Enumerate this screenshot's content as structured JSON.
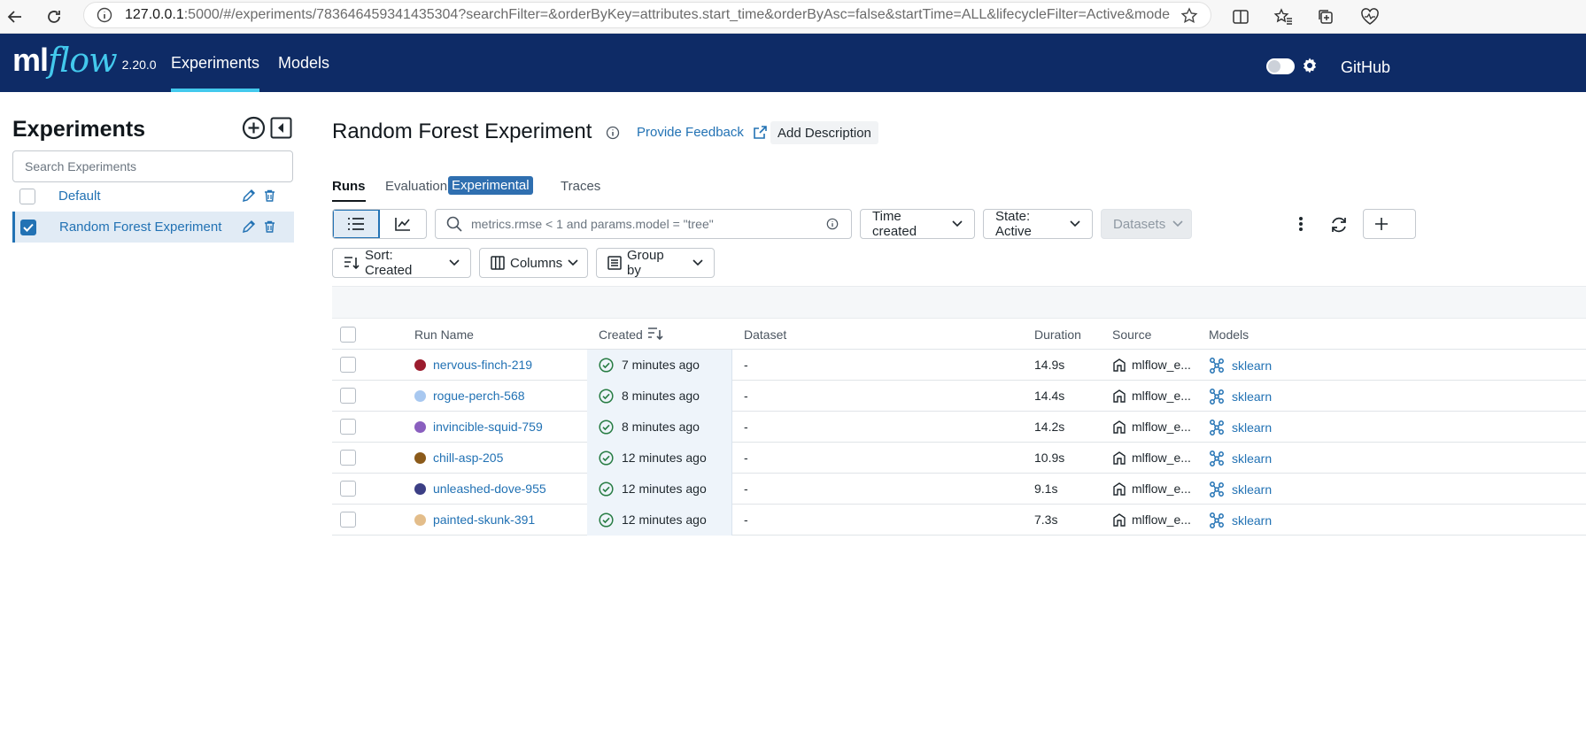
{
  "browser": {
    "url_host": "127.0.0.1",
    "url_rest": ":5000/#/experiments/783646459341435304?searchFilter=&orderByKey=attributes.start_time&orderByAsc=false&startTime=ALL&lifecycleFilter=Active&modelVers..."
  },
  "header": {
    "logo_ml": "ml",
    "logo_flow": "flow",
    "version": "2.20.0",
    "nav": [
      "Experiments",
      "Models"
    ],
    "github": "GitHub"
  },
  "sidebar": {
    "title": "Experiments",
    "search_placeholder": "Search Experiments",
    "experiments": [
      {
        "name": "Default",
        "checked": false
      },
      {
        "name": "Random Forest Experiment",
        "checked": true
      }
    ]
  },
  "main": {
    "title": "Random Forest Experiment",
    "feedback": "Provide Feedback",
    "add_description": "Add Description",
    "tabs": [
      "Runs",
      "Evaluation",
      "Traces"
    ],
    "experimental_badge": "Experimental",
    "filter_placeholder": "metrics.rmse < 1 and params.model = \"tree\"",
    "time_created": "Time created",
    "state": "State: Active",
    "datasets": "Datasets",
    "sort": "Sort: Created",
    "columns": "Columns",
    "group_by": "Group by"
  },
  "table": {
    "headers": [
      "Run Name",
      "Created",
      "Dataset",
      "Duration",
      "Source",
      "Models"
    ],
    "rows": [
      {
        "name": "nervous-finch-219",
        "color": "#9b1c2e",
        "created": "7 minutes ago",
        "dataset": "-",
        "duration": "14.9s",
        "source": "mlflow_e...",
        "model": "sklearn"
      },
      {
        "name": "rogue-perch-568",
        "color": "#a8c8f0",
        "created": "8 minutes ago",
        "dataset": "-",
        "duration": "14.4s",
        "source": "mlflow_e...",
        "model": "sklearn"
      },
      {
        "name": "invincible-squid-759",
        "color": "#8a5fbf",
        "created": "8 minutes ago",
        "dataset": "-",
        "duration": "14.2s",
        "source": "mlflow_e...",
        "model": "sklearn"
      },
      {
        "name": "chill-asp-205",
        "color": "#8b5a1a",
        "created": "12 minutes ago",
        "dataset": "-",
        "duration": "10.9s",
        "source": "mlflow_e...",
        "model": "sklearn"
      },
      {
        "name": "unleashed-dove-955",
        "color": "#3c3f85",
        "created": "12 minutes ago",
        "dataset": "-",
        "duration": "9.1s",
        "source": "mlflow_e...",
        "model": "sklearn"
      },
      {
        "name": "painted-skunk-391",
        "color": "#e3bd8a",
        "created": "12 minutes ago",
        "dataset": "-",
        "duration": "7.3s",
        "source": "mlflow_e...",
        "model": "sklearn"
      }
    ]
  }
}
